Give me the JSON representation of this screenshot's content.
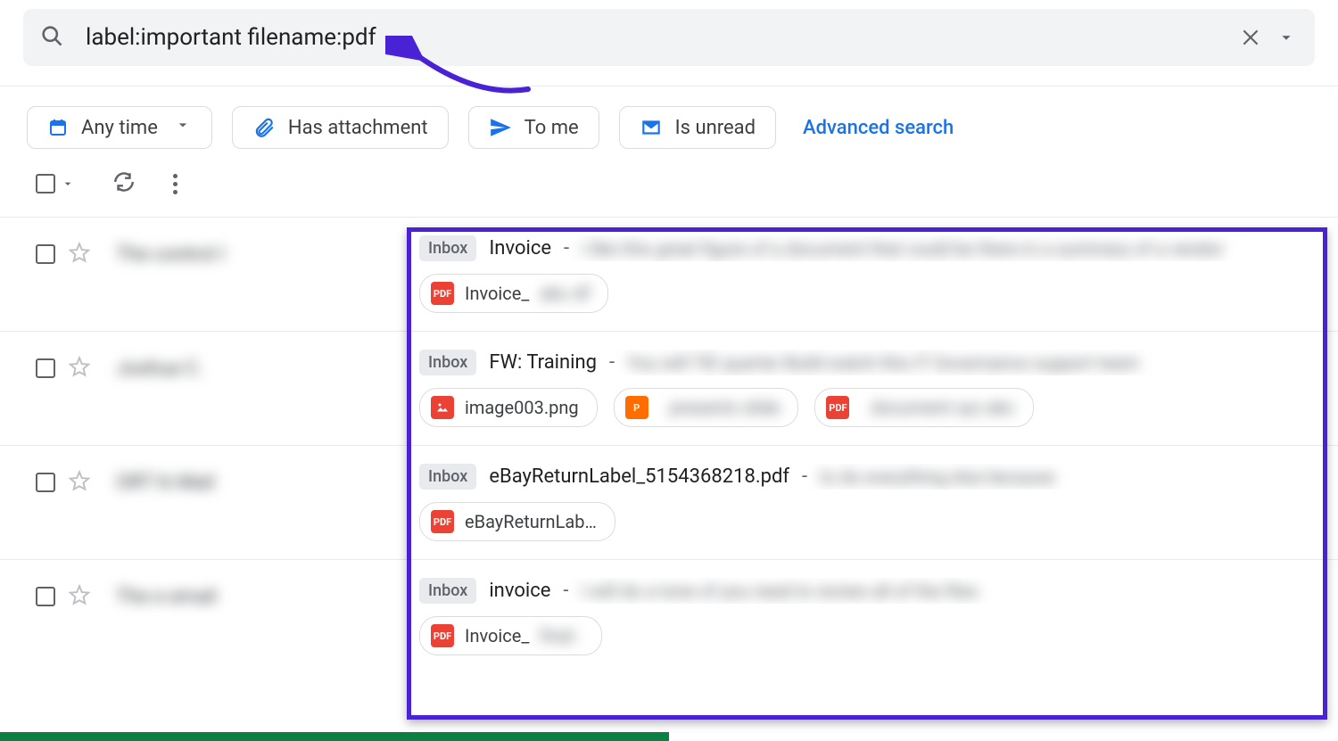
{
  "search": {
    "query": "label:important filename:pdf"
  },
  "chips": {
    "any_time": "Any time",
    "has_attachment": "Has attachment",
    "to_me": "To me",
    "is_unread": "Is unread"
  },
  "advanced_search": "Advanced search",
  "inbox_label": "Inbox",
  "rows": [
    {
      "sender_blur": "The control I",
      "subject": "Invoice",
      "sep": " - ",
      "snippet_blur": "I like this great figure of a document that could be there in a summary of a vendor",
      "attachments": [
        {
          "type": "pdf",
          "label": "Invoice_",
          "blur_suffix": "abc df"
        }
      ]
    },
    {
      "sender_blur": "Joshua    C.",
      "subject": "FW: Training",
      "sep": " - ",
      "snippet_blur": "You will TIE quarter Build watch this IT Governance support team",
      "attachments": [
        {
          "type": "img",
          "label": "image003.png",
          "blur_suffix": ""
        },
        {
          "type": "ppt",
          "label": "",
          "blur_suffix": "presentx    slide"
        },
        {
          "type": "pdf",
          "label": "",
          "blur_suffix": "document xyz abc"
        }
      ]
    },
    {
      "sender_blur": "ORT hi  Mail",
      "subject": "eBayReturnLabel_5154368218.pdf",
      "sep": " - ",
      "snippet_blur": "to do everything else because",
      "attachments": [
        {
          "type": "pdf",
          "label": "eBayReturnLab…",
          "blur_suffix": ""
        }
      ]
    },
    {
      "sender_blur": "The e email",
      "subject": "invoice",
      "sep": " - ",
      "snippet_blur": "I    will do    a tone of    you need    to review    all of the    files",
      "attachments": [
        {
          "type": "pdf",
          "label": "Invoice_",
          "blur_suffix": "final ."
        }
      ]
    }
  ]
}
